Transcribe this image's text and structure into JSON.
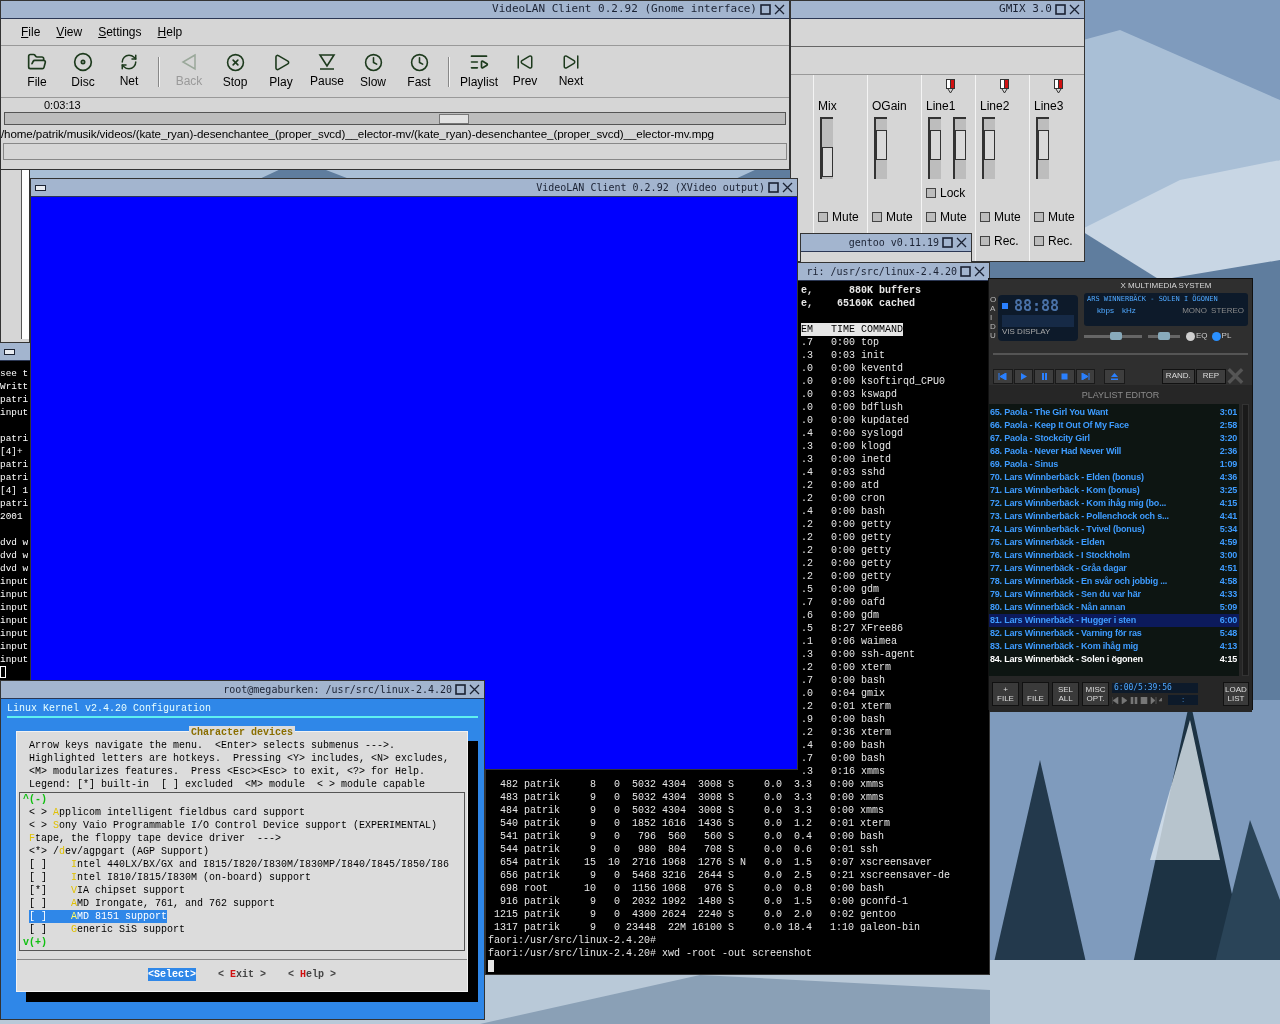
{
  "vlc_window": {
    "title": "VideoLAN Client 0.2.92 (Gnome interface)",
    "menu": [
      "File",
      "View",
      "Settings",
      "Help"
    ],
    "toolbar": [
      [
        {
          "label": "File",
          "disabled": false
        },
        {
          "label": "Disc",
          "disabled": false
        },
        {
          "label": "Net",
          "disabled": false
        }
      ],
      [
        {
          "label": "Back",
          "disabled": true
        },
        {
          "label": "Stop",
          "disabled": false
        },
        {
          "label": "Play",
          "disabled": false
        },
        {
          "label": "Pause",
          "disabled": false
        },
        {
          "label": "Slow",
          "disabled": false
        },
        {
          "label": "Fast",
          "disabled": false
        }
      ],
      [
        {
          "label": "Playlist",
          "disabled": false
        },
        {
          "label": "Prev",
          "disabled": false
        },
        {
          "label": "Next",
          "disabled": false
        }
      ]
    ],
    "time": "0:03:13",
    "seek": {
      "level": 0.575
    },
    "file_path": "/home/patrik/musik/videos/(kate_ryan)-desenchantee_(proper_svcd)__elector-mv/(kate_ryan)-desenchantee_(proper_svcd)__elector-mv.mpg"
  },
  "gmix_window": {
    "title": "GMIX 3.0",
    "channels": [
      {
        "name": "Mix",
        "recordable": false,
        "sliders": [
          {
            "level": 0.08
          }
        ],
        "mute": {
          "label": "Mute",
          "checked": false
        }
      },
      {
        "name": "OGain",
        "recordable": false,
        "sliders": [
          {
            "level": 0.62
          }
        ],
        "mute": {
          "label": "Mute",
          "checked": false
        }
      },
      {
        "name": "Line1",
        "recordable": true,
        "sliders": [
          {
            "level": 0.62
          },
          {
            "level": 0.62
          }
        ],
        "lock": {
          "label": "Lock",
          "checked": false
        },
        "mute": {
          "label": "Mute",
          "checked": false
        }
      },
      {
        "name": "Line2",
        "recordable": true,
        "sliders": [
          {
            "level": 0.62
          }
        ],
        "mute": {
          "label": "Mute",
          "checked": false
        },
        "rec": {
          "label": "Rec.",
          "checked": false
        }
      },
      {
        "name": "Line3",
        "recordable": true,
        "sliders": [
          {
            "level": 0.62
          }
        ],
        "mute": {
          "label": "Mute",
          "checked": false
        },
        "rec": {
          "label": "Rec.",
          "checked": false
        }
      }
    ]
  },
  "gentoo_window": {
    "title": "gentoo v0.11.19"
  },
  "xvideo_window": {
    "title": "VideoLAN Client 0.2.92 (XVideo output)"
  },
  "left_terminal": {
    "blocks": [
      [
        "see t",
        "Writt",
        "patri",
        "input"
      ],
      [
        "patri",
        "[4]+",
        "patri",
        "patri",
        "[4] 1",
        "patri",
        "2001"
      ],
      [
        "dvd w",
        "dvd w",
        "dvd w",
        "input",
        "input",
        "input",
        "input",
        "input",
        "input",
        "input"
      ]
    ]
  },
  "top_terminal": {
    "title": "ri: /usr/src/linux-2.4.20",
    "summary_lines": [
      "e,      880K buffers",
      "e,    65160K cached"
    ],
    "header": "EM   TIME COMMAND",
    "fragments": [
      ".7   0:00 top",
      ".3   0:03 init",
      ".0   0:00 keventd",
      ".0   0:00 ksoftirqd_CPU0",
      ".0   0:03 kswapd",
      ".0   0:00 bdflush",
      ".0   0:00 kupdated",
      ".4   0:00 syslogd",
      ".3   0:00 klogd",
      ".3   0:00 inetd",
      ".4   0:03 sshd",
      ".2   0:00 atd",
      ".2   0:00 cron",
      ".4   0:00 bash",
      ".2   0:00 getty",
      ".2   0:00 getty",
      ".2   0:00 getty",
      ".2   0:00 getty",
      ".2   0:00 getty",
      ".5   0:00 gdm",
      ".7   0:00 oafd",
      ".6   0:00 gdm",
      ".5   8:27 XFree86",
      ".1   0:06 waimea",
      ".3   0:00 ssh-agent",
      ".2   0:00 xterm",
      ".7   0:00 bash",
      ".0   0:04 gmix",
      ".2   0:01 xterm",
      ".9   0:00 bash",
      ".2   0:36 xterm",
      ".4   0:00 bash",
      ".7   0:00 bash",
      ".3   0:16 xmms"
    ],
    "rows": [
      "  482 patrik     8   0  5032 4304  3008 S     0.0  3.3   0:00 xmms",
      "  483 patrik     9   0  5032 4304  3008 S     0.0  3.3   0:00 xmms",
      "  484 patrik     9   0  5032 4304  3008 S     0.0  3.3   0:00 xmms",
      "  540 patrik     9   0  1852 1616  1436 S     0.0  1.2   0:01 xterm",
      "  541 patrik     9   0   796  560   560 S     0.0  0.4   0:00 bash",
      "  544 patrik     9   0   980  804   708 S     0.0  0.6   0:01 ssh",
      "  654 patrik    15  10  2716 1968  1276 S N   0.0  1.5   0:07 xscreensaver",
      "  656 patrik     9   0  5468 3216  2644 S     0.0  2.5   0:21 xscreensaver-de",
      "  698 root      10   0  1156 1068   976 S     0.0  0.8   0:00 bash",
      "  916 patrik     9   0  2032 1992  1480 S     0.0  1.5   0:00 gconfd-1",
      " 1215 patrik     9   0  4300 2624  2240 S     0.0  2.0   0:02 gentoo",
      " 1317 patrik     9   0 23448  22M 16100 S     0.0 18.4   1:10 galeon-bin"
    ],
    "prompt_lines": [
      "faori:/usr/src/linux-2.4.20#",
      "faori:/usr/src/linux-2.4.20# xwd -root -out screenshot"
    ]
  },
  "kernel_config": {
    "title": "root@megaburken: /usr/src/linux-2.4.20",
    "heading": "Linux Kernel v2.4.20 Configuration",
    "dialog_title": "Character devices",
    "help_lines": [
      "Arrow keys navigate the menu.  <Enter> selects submenus --->.",
      "Highlighted letters are hotkeys.  Pressing <Y> includes, <N> excludes,",
      "<M> modularizes features.  Press <Esc><Esc> to exit, <?> for Help.",
      "Legend: [*] built-in  [ ] excluded  <M> module  < > module capable"
    ],
    "scroll_up": "^(-)",
    "scroll_down": "v(+)",
    "items": [
      {
        "mark": "< >",
        "hotkey": "A",
        "rest": "pplicom intelligent fieldbus card support",
        "selected": false
      },
      {
        "mark": "< >",
        "hotkey": "S",
        "rest": "ony Vaio Programmable I/O Control Device support (EXPERIMENTAL)",
        "selected": false
      },
      {
        "hotkey": "F",
        "rest": "tape, the floppy tape device driver  --->",
        "selected": false
      },
      {
        "mark": "<*>",
        "lead": "/",
        "hotkey": "d",
        "rest": "ev/agpgart (AGP Support)",
        "selected": false,
        "children": [
          {
            "mark": "[ ]",
            "hotkey": "I",
            "rest": "ntel 440LX/BX/GX and I815/I820/I830M/I830MP/I840/I845/I850/I86",
            "selected": false
          },
          {
            "mark": "[ ]",
            "hotkey": "I",
            "rest": "ntel I810/I815/I830M (on-board) support",
            "selected": false
          },
          {
            "mark": "[*]",
            "hotkey": "V",
            "rest": "IA chipset support",
            "selected": false
          },
          {
            "mark": "[ ]",
            "hotkey": "A",
            "rest": "MD Irongate, 761, and 762 support",
            "selected": false
          },
          {
            "mark": "[ ]",
            "hotkey": "A",
            "rest": "MD 8151 support",
            "selected": true
          },
          {
            "mark": "[ ]",
            "hotkey": "G",
            "rest": "eneric SiS support",
            "selected": false
          }
        ]
      }
    ],
    "buttons": [
      {
        "lead": "<",
        "hotkey": "S",
        "rest": "elect>",
        "selected": true
      },
      {
        "lead": "< ",
        "hotkey": "E",
        "rest": "xit >",
        "selected": false
      },
      {
        "lead": "< ",
        "hotkey": "H",
        "rest": "elp >",
        "selected": false
      }
    ]
  },
  "xmms": {
    "title": "X MULTIMEDIA SYSTEM",
    "clutterbar": [
      "O",
      "A",
      "I",
      "D",
      "U"
    ],
    "time_display": "88:88",
    "vis_label": "VIS DISPLAY",
    "song": "ARS WINNERBÄCK - SOLEN I ÖGONEN",
    "kbps": "kbps",
    "khz": "kHz",
    "mono": {
      "label": "MONO",
      "on": false
    },
    "stereo": {
      "label": "STEREO",
      "on": false
    },
    "volume": {
      "level": 0.55
    },
    "balance": {
      "level": 0.5
    },
    "eq": {
      "label": "EQ",
      "on": false
    },
    "pl": {
      "label": "PL",
      "on": true
    },
    "shuffle": {
      "label": "RAND.",
      "on": false
    },
    "repeat": {
      "label": "REP",
      "on": false
    },
    "playlist": {
      "title": "PLAYLIST EDITOR",
      "items": [
        {
          "title": "65. Paola - The Girl You Want",
          "time": "3:01",
          "selected": false,
          "playing": false
        },
        {
          "title": "66. Paola - Keep It Out Of My Face",
          "time": "2:58",
          "selected": false,
          "playing": false
        },
        {
          "title": "67. Paola - Stockcity Girl",
          "time": "3:20",
          "selected": false,
          "playing": false
        },
        {
          "title": "68. Paola - Never Had Never Will",
          "time": "2:36",
          "selected": false,
          "playing": false
        },
        {
          "title": "69. Paola - Sinus",
          "time": "1:09",
          "selected": false,
          "playing": false
        },
        {
          "title": "70. Lars Winnberbäck - Elden (bonus)",
          "time": "4:36",
          "selected": false,
          "playing": false
        },
        {
          "title": "71. Lars Winnberbäck - Kom (bonus)",
          "time": "3:25",
          "selected": false,
          "playing": false
        },
        {
          "title": "72. Lars Winnberbäck - Kom ihåg mig (bo...",
          "time": "4:15",
          "selected": false,
          "playing": false
        },
        {
          "title": "73. Lars Winnberbäck - Pollenchock och s...",
          "time": "4:41",
          "selected": false,
          "playing": false
        },
        {
          "title": "74. Lars Winnberbäck - Tvivel (bonus)",
          "time": "5:34",
          "selected": false,
          "playing": false
        },
        {
          "title": "75. Lars Winnerbäck - Elden",
          "time": "4:59",
          "selected": false,
          "playing": false
        },
        {
          "title": "76. Lars Winnerbäck - I Stockholm",
          "time": "3:00",
          "selected": false,
          "playing": false
        },
        {
          "title": "77. Lars Winnerbäck - Gråa dagar",
          "time": "4:51",
          "selected": false,
          "playing": false
        },
        {
          "title": "78. Lars Winnerbäck - En svår och jobbig ...",
          "time": "4:58",
          "selected": false,
          "playing": false
        },
        {
          "title": "79. Lars Winnerbäck - Sen du var här",
          "time": "4:33",
          "selected": false,
          "playing": false
        },
        {
          "title": "80. Lars Winnerbäck - Nån annan",
          "time": "5:09",
          "selected": false,
          "playing": false
        },
        {
          "title": "81. Lars Winnerbäck - Hugger i sten",
          "time": "6:00",
          "selected": true,
          "playing": false
        },
        {
          "title": "82. Lars Winnerbäck - Varning för ras",
          "time": "5:48",
          "selected": false,
          "playing": false
        },
        {
          "title": "83. Lars Winnerbäck - Kom ihåg mig",
          "time": "4:13",
          "selected": false,
          "playing": false
        },
        {
          "title": "84. Lars Winnerbäck - Solen i ögonen",
          "time": "4:15",
          "selected": false,
          "playing": true
        }
      ],
      "buttons": [
        [
          "+",
          "FILE"
        ],
        [
          "-",
          "FILE"
        ],
        [
          "SEL",
          "ALL"
        ],
        [
          "MISC",
          "OPT."
        ]
      ],
      "time": "6:00/5:39:56",
      "mini_time": ":",
      "load": [
        "LOAD",
        "LIST"
      ]
    }
  }
}
